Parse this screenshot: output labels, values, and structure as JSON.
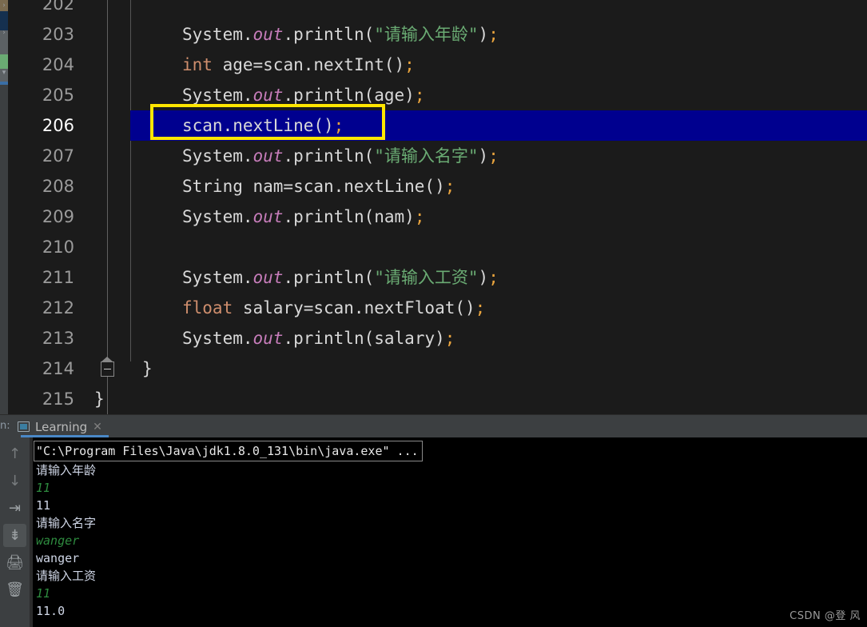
{
  "editor": {
    "highlighted_line": 206,
    "annotation_color": "#ffe600",
    "current_line_bg": "#00008f",
    "lines": [
      {
        "num": "202",
        "tokens": []
      },
      {
        "num": "203",
        "tokens": [
          {
            "t": "System",
            "c": "plain"
          },
          {
            "t": ".",
            "c": "plain"
          },
          {
            "t": "out",
            "c": "field"
          },
          {
            "t": ".println(",
            "c": "plain"
          },
          {
            "t": "\"请输入年龄\"",
            "c": "str"
          },
          {
            "t": ")",
            "c": "plain"
          },
          {
            "t": ";",
            "c": "punct"
          }
        ]
      },
      {
        "num": "204",
        "tokens": [
          {
            "t": "int",
            "c": "kw"
          },
          {
            "t": " age=scan.nextInt()",
            "c": "plain"
          },
          {
            "t": ";",
            "c": "punct"
          }
        ]
      },
      {
        "num": "205",
        "tokens": [
          {
            "t": "System",
            "c": "plain"
          },
          {
            "t": ".",
            "c": "plain"
          },
          {
            "t": "out",
            "c": "field"
          },
          {
            "t": ".println(age)",
            "c": "plain"
          },
          {
            "t": ";",
            "c": "punct"
          }
        ]
      },
      {
        "num": "206",
        "tokens": [
          {
            "t": "scan.nextLine()",
            "c": "plain"
          },
          {
            "t": ";",
            "c": "punct"
          }
        ]
      },
      {
        "num": "207",
        "tokens": [
          {
            "t": "System",
            "c": "plain"
          },
          {
            "t": ".",
            "c": "plain"
          },
          {
            "t": "out",
            "c": "field"
          },
          {
            "t": ".println(",
            "c": "plain"
          },
          {
            "t": "\"请输入名字\"",
            "c": "str"
          },
          {
            "t": ")",
            "c": "plain"
          },
          {
            "t": ";",
            "c": "punct"
          }
        ]
      },
      {
        "num": "208",
        "tokens": [
          {
            "t": "String nam=scan.nextLine()",
            "c": "plain"
          },
          {
            "t": ";",
            "c": "punct"
          }
        ]
      },
      {
        "num": "209",
        "tokens": [
          {
            "t": "System",
            "c": "plain"
          },
          {
            "t": ".",
            "c": "plain"
          },
          {
            "t": "out",
            "c": "field"
          },
          {
            "t": ".println(nam)",
            "c": "plain"
          },
          {
            "t": ";",
            "c": "punct"
          }
        ]
      },
      {
        "num": "210",
        "tokens": []
      },
      {
        "num": "211",
        "tokens": [
          {
            "t": "System",
            "c": "plain"
          },
          {
            "t": ".",
            "c": "plain"
          },
          {
            "t": "out",
            "c": "field"
          },
          {
            "t": ".println(",
            "c": "plain"
          },
          {
            "t": "\"请输入工资\"",
            "c": "str"
          },
          {
            "t": ")",
            "c": "plain"
          },
          {
            "t": ";",
            "c": "punct"
          }
        ]
      },
      {
        "num": "212",
        "tokens": [
          {
            "t": "float",
            "c": "kw"
          },
          {
            "t": " salary=scan.nextFloat()",
            "c": "plain"
          },
          {
            "t": ";",
            "c": "punct"
          }
        ]
      },
      {
        "num": "213",
        "tokens": [
          {
            "t": "System",
            "c": "plain"
          },
          {
            "t": ".",
            "c": "plain"
          },
          {
            "t": "out",
            "c": "field"
          },
          {
            "t": ".println(salary)",
            "c": "plain"
          },
          {
            "t": ";",
            "c": "punct"
          }
        ]
      },
      {
        "num": "214",
        "tokens": [
          {
            "t": "}",
            "c": "brace"
          }
        ]
      },
      {
        "num": "215",
        "tokens": [
          {
            "t": "}",
            "c": "brace"
          }
        ]
      }
    ],
    "fold_marker_line": "214",
    "fold_marker_glyph": "minus"
  },
  "run_panel": {
    "panel_label": "n:",
    "tab": {
      "title": "Learning",
      "close_glyph": "✕",
      "icon_name": "run-configuration-icon"
    },
    "toolbar": [
      {
        "name": "scroll-up-button",
        "glyph": "↑",
        "active": false,
        "dim": true
      },
      {
        "name": "scroll-down-button",
        "glyph": "↓",
        "active": false,
        "dim": true
      },
      {
        "name": "soft-wrap-button",
        "glyph": "⇥",
        "active": false,
        "dim": false
      },
      {
        "name": "scroll-to-end-button",
        "glyph": "⇟",
        "active": true,
        "dim": false
      },
      {
        "name": "print-button",
        "glyph": "🖨",
        "active": false,
        "dim": false
      },
      {
        "name": "clear-all-button",
        "glyph": "🗑",
        "active": false,
        "dim": false
      }
    ],
    "command_line": "\"C:\\Program Files\\Java\\jdk1.8.0_131\\bin\\java.exe\" ...",
    "output": [
      {
        "text": "请输入年龄",
        "kind": "out"
      },
      {
        "text": "11",
        "kind": "input"
      },
      {
        "text": "11",
        "kind": "out"
      },
      {
        "text": "请输入名字",
        "kind": "out"
      },
      {
        "text": "wanger",
        "kind": "input"
      },
      {
        "text": "wanger",
        "kind": "out"
      },
      {
        "text": "请输入工资",
        "kind": "out"
      },
      {
        "text": "11",
        "kind": "input"
      },
      {
        "text": "11.0",
        "kind": "out"
      }
    ]
  },
  "watermark": "CSDN @登 风"
}
